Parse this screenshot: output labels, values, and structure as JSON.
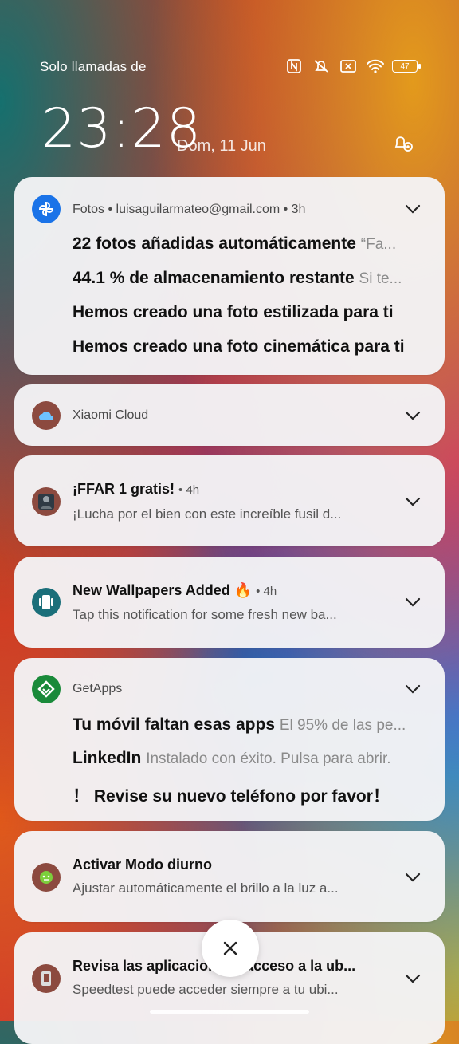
{
  "status": {
    "carrier": "Solo llamadas de",
    "battery": "47",
    "icons": [
      "nfc-icon",
      "mute-icon",
      "no-sim-icon",
      "wifi-icon",
      "battery-icon"
    ]
  },
  "lockscreen": {
    "time": "23:28",
    "date": "Dom, 11 Jun"
  },
  "notifications": {
    "fotos": {
      "app": "Fotos",
      "account": "luisaguilarmateo@gmail.com",
      "time": "3h",
      "header": "Fotos • luisaguilarmateo@gmail.com • 3h",
      "lines": [
        {
          "title": "22 fotos añadidas automáticamente",
          "sub": "“Fa..."
        },
        {
          "title": "44.1 % de almacenamiento restante",
          "sub": "Si te..."
        },
        {
          "title": "Hemos creado una foto estilizada para ti",
          "sub": ""
        },
        {
          "title": "Hemos creado una foto cinemática para ti",
          "sub": ""
        }
      ]
    },
    "xiaomi": {
      "app": "Xiaomi Cloud"
    },
    "ffar": {
      "title": "¡FFAR 1 gratis!",
      "time": "• 4h",
      "body": "¡Lucha por el bien con este increíble fusil d..."
    },
    "wallpapers": {
      "title": "New Wallpapers Added 🔥",
      "time": "• 4h",
      "body": "Tap this notification for some fresh new ba..."
    },
    "getapps": {
      "app": "GetApps",
      "lines": [
        {
          "title": "Tu móvil faltan esas apps",
          "sub": "El 95% de las pe..."
        },
        {
          "title": "LinkedIn",
          "sub": "Instalado con éxito. Pulsa para abrir."
        },
        {
          "title": "！ Revise su nuevo teléfono por favor！",
          "sub": ""
        }
      ]
    },
    "daymode": {
      "title": "Activar Modo diurno",
      "body": "Ajustar automáticamente el brillo a la luz a..."
    },
    "location": {
      "title": "Revisa las aplicacio... on acceso a la ub...",
      "body": "Speedtest puede acceder siempre a tu ubi..."
    }
  },
  "colors": {
    "fotos_icon": "#1a73e8",
    "cloud_icon": "#8c4a3f",
    "wallpaper_icon": "#1b6f7a",
    "getapps_icon": "#1a8a3a",
    "daymode_icon": "#8c4a3f"
  }
}
